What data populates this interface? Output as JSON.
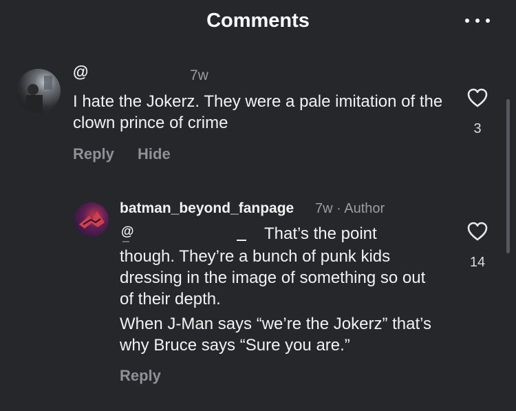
{
  "header": {
    "title": "Comments"
  },
  "comments": [
    {
      "username": "@",
      "time": "7w",
      "text": "I hate the Jokerz.  They were a pale imitation of the clown prince of crime",
      "likes": "3",
      "actions": {
        "reply": "Reply",
        "hide": "Hide"
      }
    },
    {
      "username": "batman_beyond_fanpage",
      "meta": "7w · Author",
      "mention": "@",
      "text_first_line_end": "That’s the point",
      "text_body": "though. They’re a bunch of punk kids dressing in the image of something so out of their depth.",
      "text_paragraph2": "When J-Man says “we’re the Jokerz” that’s why Bruce says “Sure you are.”",
      "likes": "14",
      "actions": {
        "reply": "Reply"
      }
    }
  ],
  "icons": {
    "more": "more-dots-icon",
    "like": "heart-outline-icon"
  },
  "colors": {
    "background": "#25272a",
    "text": "#f2f2f2",
    "muted": "#8e9196"
  }
}
